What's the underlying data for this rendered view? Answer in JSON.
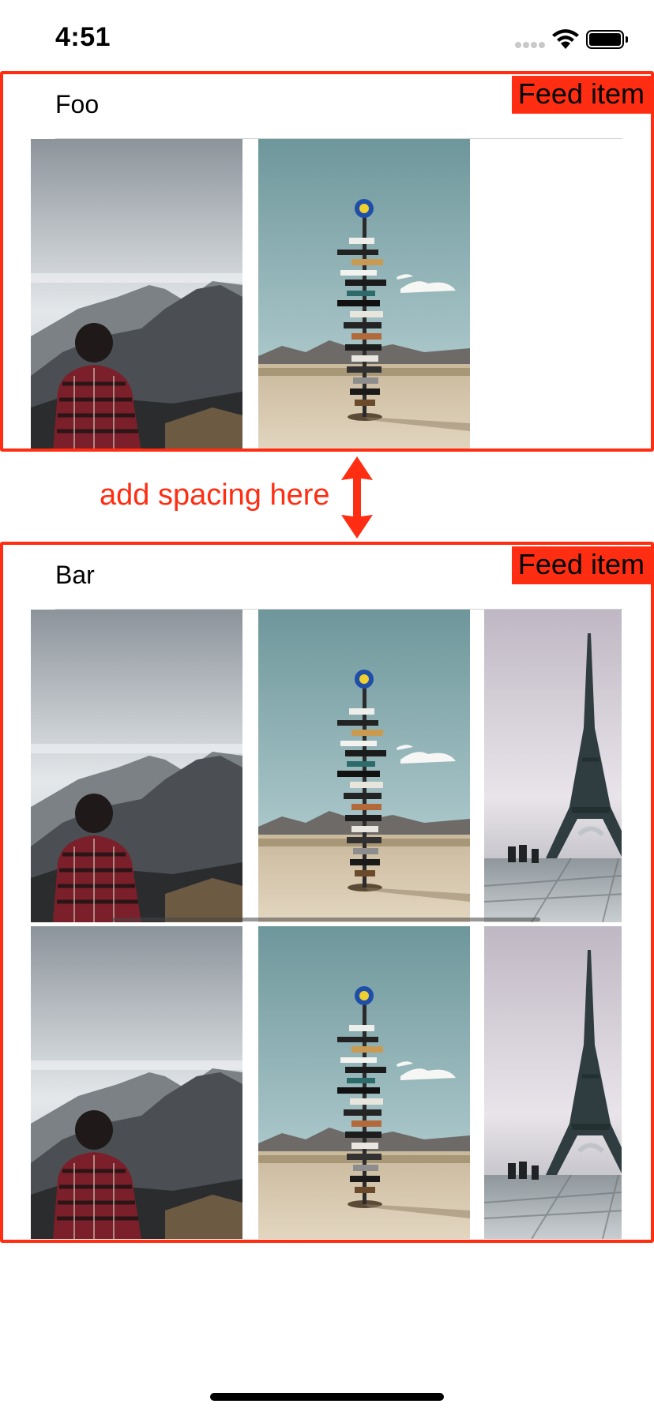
{
  "status_bar": {
    "time": "4:51"
  },
  "feed": {
    "items": [
      {
        "title": "Foo",
        "tag": "Feed item"
      },
      {
        "title": "Bar",
        "tag": "Feed item"
      }
    ]
  },
  "annotation": {
    "spacing_note": "add spacing here"
  },
  "colors": {
    "annotation": "#ff2d12",
    "divider": "#d2d2d2"
  },
  "icons": [
    "signal-dots-icon",
    "wifi-icon",
    "battery-icon",
    "double-arrow-icon"
  ]
}
